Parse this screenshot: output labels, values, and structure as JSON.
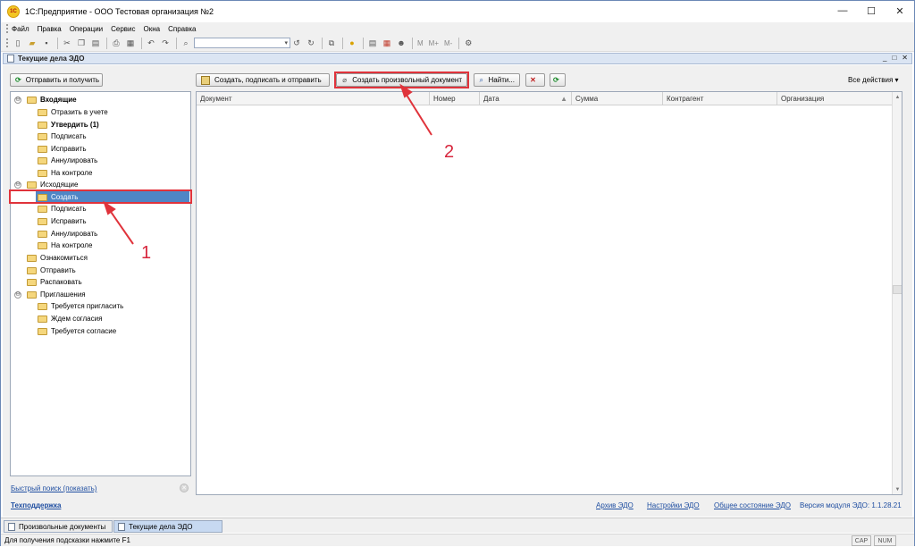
{
  "window": {
    "title": "1С:Предприятие - ООО Тестовая организация №2",
    "logo_text": "1С",
    "controls": {
      "minimize": "—",
      "maximize": "☐",
      "close": "✕"
    }
  },
  "menu": [
    "Файл",
    "Правка",
    "Операции",
    "Сервис",
    "Окна",
    "Справка"
  ],
  "toolbar": {
    "icons": [
      "new-document-icon",
      "open-folder-icon",
      "save-icon",
      "cut-icon",
      "copy-icon",
      "paste-icon",
      "print-icon",
      "print-preview-icon",
      "undo-icon",
      "redo-icon",
      "search-icon",
      "find-next-icon",
      "find-previous-icon",
      "windows-icon",
      "help-icon",
      "calculator-icon",
      "calendar-icon",
      "users-icon"
    ],
    "memory_labels": [
      "M",
      "M+",
      "M-"
    ]
  },
  "document_tab": {
    "title": "Текущие дела ЭДО",
    "controls": [
      "_",
      "□",
      "✕"
    ]
  },
  "actions": {
    "send_receive": "Отправить и получить",
    "create_sign_send": "Создать, подписать и отправить",
    "create_arbitrary": "Создать произвольный документ",
    "find": "Найти...",
    "all_actions": "Все действия"
  },
  "tree": [
    {
      "label": "Входящие",
      "level": 0,
      "expander": "⊖",
      "bold": true
    },
    {
      "label": "Отразить в учете",
      "level": 1
    },
    {
      "label": "Утвердить (1)",
      "level": 1,
      "bold": true
    },
    {
      "label": "Подписать",
      "level": 1
    },
    {
      "label": "Исправить",
      "level": 1
    },
    {
      "label": "Аннулировать",
      "level": 1
    },
    {
      "label": "На контроле",
      "level": 1
    },
    {
      "label": "Исходящие",
      "level": 0,
      "expander": "⊖"
    },
    {
      "label": "Создать",
      "level": 1,
      "selected": true
    },
    {
      "label": "Подписать",
      "level": 1
    },
    {
      "label": "Исправить",
      "level": 1
    },
    {
      "label": "Аннулировать",
      "level": 1
    },
    {
      "label": "На контроле",
      "level": 1
    },
    {
      "label": "Ознакомиться",
      "level": 0
    },
    {
      "label": "Отправить",
      "level": 0
    },
    {
      "label": "Распаковать",
      "level": 0
    },
    {
      "label": "Приглашения",
      "level": 0,
      "expander": "⊖"
    },
    {
      "label": "Требуется пригласить",
      "level": 1
    },
    {
      "label": "Ждем согласия",
      "level": 1
    },
    {
      "label": "Требуется согласие",
      "level": 1
    }
  ],
  "grid": {
    "columns": [
      "Документ",
      "Номер",
      "Дата",
      "Сумма",
      "Контрагент",
      "Организация"
    ],
    "sort_indicator": "▲",
    "rows": []
  },
  "quick_search": "Быстрый поиск (показать)",
  "support": "Техподдержка",
  "footer_links": [
    "Архив ЭДО",
    "Настройки ЭДО",
    "Общее состояние ЭДО"
  ],
  "module_version": "Версия модуля ЭДО: 1.1.28.21",
  "taskbar": [
    {
      "label": "Произвольные документы",
      "active": false
    },
    {
      "label": "Текущие дела ЭДО",
      "active": true
    }
  ],
  "status": {
    "hint": "Для получения подсказки нажмите F1",
    "indicators": [
      "CAP",
      "NUM"
    ]
  },
  "annotations": {
    "marker1": "1",
    "marker2": "2",
    "color": "#e0333b"
  }
}
